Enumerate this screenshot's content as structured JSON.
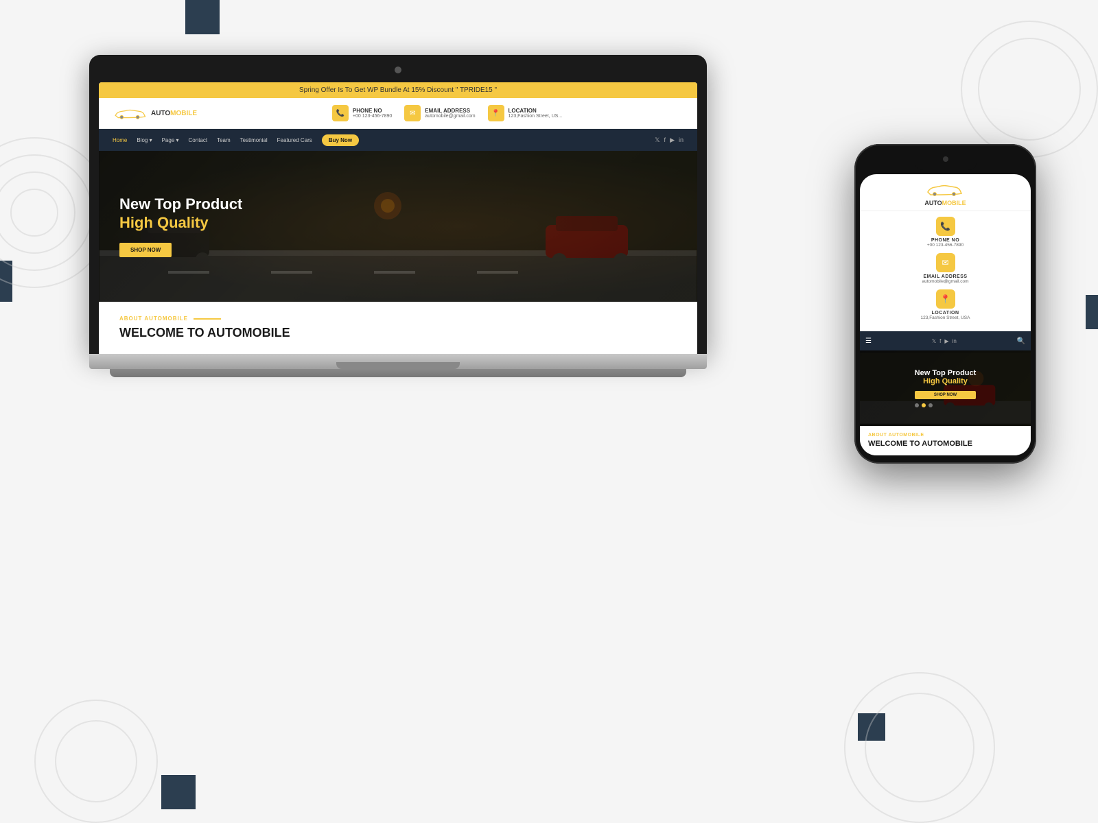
{
  "background": {
    "color": "#f5f5f5"
  },
  "laptop": {
    "site": {
      "banner": "Spring Offer Is To Get WP Bundle At 15% Discount \" TPRIDE15 \"",
      "logo": {
        "prefix": "AUTO",
        "suffix": "MOBILE"
      },
      "contact": {
        "phone": {
          "label": "PHONE NO",
          "value": "+00 123-456-7890",
          "icon": "📞"
        },
        "email": {
          "label": "EMAIL ADDRESS",
          "value": "automobile@gmail.com",
          "icon": "✉"
        },
        "location": {
          "label": "LOCATION",
          "value": "123,Fashion Street, US...",
          "icon": "📍"
        }
      },
      "nav": {
        "items": [
          "Home",
          "Blog",
          "Page",
          "Contact",
          "Team",
          "Testimonial",
          "Featured Cars"
        ],
        "cta": "Buy Now",
        "social": [
          "𝕏",
          "f",
          "▶",
          "in"
        ]
      },
      "hero": {
        "line1": "New Top Product",
        "line2_prefix": "High ",
        "line2_highlight": "Quality",
        "button": "SHOP NOW"
      },
      "about": {
        "label": "ABOUT AUTOMOBILE",
        "title": "WELCOME TO AUTOMOBILE"
      }
    }
  },
  "phone": {
    "site": {
      "logo": {
        "prefix": "AUTO",
        "suffix": "MOBILE"
      },
      "contact": {
        "phone": {
          "label": "PHONE NO",
          "value": "+00 123-456-7890",
          "icon": "📞"
        },
        "email": {
          "label": "EMAIL ADDRESS",
          "value": "automobile@gmail.com",
          "icon": "✉"
        },
        "location": {
          "label": "LOCATION",
          "value": "123,Fashion Street, USA",
          "icon": "📍"
        }
      },
      "nav": {
        "menu_icon": "☰",
        "social": [
          "𝕏",
          "f",
          "▶",
          "in"
        ],
        "search_icon": "🔍"
      },
      "hero": {
        "line1": "New Top Product",
        "line2_prefix": "High ",
        "line2_highlight": "Quality",
        "button": "SHOP NOW",
        "dots": [
          false,
          true,
          false
        ]
      },
      "about": {
        "label": "ABOUT AUTOMOBILE",
        "title": "WELCOME TO AUTOMOBILE"
      }
    }
  }
}
